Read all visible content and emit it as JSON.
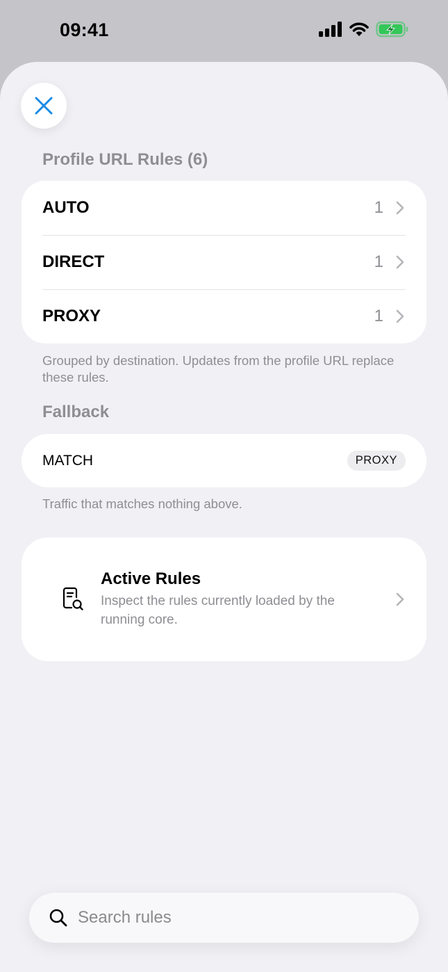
{
  "status_bar": {
    "time": "09:41"
  },
  "profile_section": {
    "header": "Profile URL Rules (6)",
    "rows": [
      {
        "name": "AUTO",
        "count": "1"
      },
      {
        "name": "DIRECT",
        "count": "1"
      },
      {
        "name": "PROXY",
        "count": "1"
      }
    ],
    "footnote": "Grouped by destination. Updates from the profile URL replace these rules."
  },
  "fallback_section": {
    "header": "Fallback",
    "label": "MATCH",
    "badge": "PROXY",
    "footnote": "Traffic that matches nothing above."
  },
  "active_rules": {
    "title": "Active Rules",
    "subtitle": "Inspect the rules currently loaded by the running core."
  },
  "search": {
    "placeholder": "Search rules"
  },
  "colors": {
    "accent": "#1a8ae5",
    "battery": "#34c759",
    "secondary_text": "#8e8e93"
  }
}
